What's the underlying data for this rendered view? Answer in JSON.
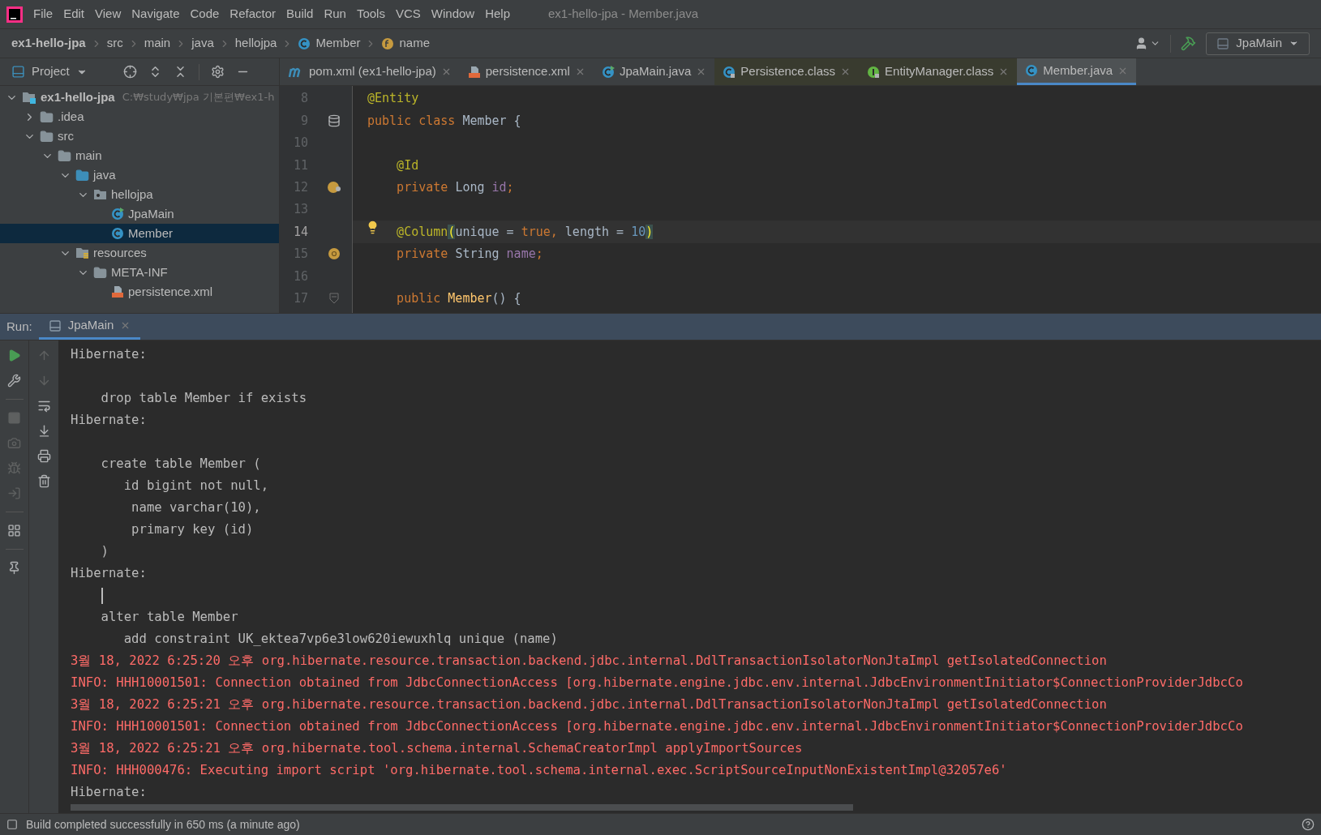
{
  "window": {
    "title": "ex1-hello-jpa - Member.java"
  },
  "menu": [
    "File",
    "Edit",
    "View",
    "Navigate",
    "Code",
    "Refactor",
    "Build",
    "Run",
    "Tools",
    "VCS",
    "Window",
    "Help"
  ],
  "breadcrumbs": [
    {
      "label": "ex1-hello-jpa",
      "kind": "project"
    },
    {
      "label": "src",
      "kind": "folder"
    },
    {
      "label": "main",
      "kind": "folder"
    },
    {
      "label": "java",
      "kind": "folder"
    },
    {
      "label": "hellojpa",
      "kind": "folder"
    },
    {
      "label": "Member",
      "kind": "class"
    },
    {
      "label": "name",
      "kind": "field"
    }
  ],
  "run_config": {
    "label": "JpaMain"
  },
  "project": {
    "title": "Project",
    "tree": [
      {
        "label": "ex1-hello-jpa",
        "hint": "C:₩study₩jpa 기본편₩ex1-h",
        "kind": "module",
        "expanded": true,
        "selected": false,
        "children": [
          {
            "label": ".idea",
            "kind": "folder",
            "expanded": false,
            "selected": false
          },
          {
            "label": "src",
            "kind": "folder",
            "expanded": true,
            "selected": false,
            "children": [
              {
                "label": "main",
                "kind": "folder",
                "expanded": true,
                "selected": false,
                "children": [
                  {
                    "label": "java",
                    "kind": "source",
                    "expanded": true,
                    "selected": false,
                    "children": [
                      {
                        "label": "hellojpa",
                        "kind": "package",
                        "expanded": true,
                        "selected": false,
                        "children": [
                          {
                            "label": "JpaMain",
                            "kind": "class-run",
                            "selected": false
                          },
                          {
                            "label": "Member",
                            "kind": "class",
                            "selected": true
                          }
                        ]
                      }
                    ]
                  },
                  {
                    "label": "resources",
                    "kind": "resources",
                    "expanded": true,
                    "selected": false,
                    "children": [
                      {
                        "label": "META-INF",
                        "kind": "folder",
                        "expanded": true,
                        "selected": false,
                        "children": [
                          {
                            "label": "persistence.xml",
                            "kind": "xml",
                            "selected": false
                          }
                        ]
                      }
                    ]
                  }
                ]
              }
            ]
          }
        ]
      }
    ]
  },
  "tabs": [
    {
      "label": "pom.xml (ex1-hello-jpa)",
      "kind": "maven",
      "selected": false
    },
    {
      "label": "persistence.xml",
      "kind": "xml",
      "selected": false
    },
    {
      "label": "JpaMain.java",
      "kind": "class-run",
      "selected": false
    },
    {
      "label": "Persistence.class",
      "kind": "class-locked",
      "selected": false
    },
    {
      "label": "EntityManager.class",
      "kind": "interface-locked",
      "selected": false
    },
    {
      "label": "Member.java",
      "kind": "class",
      "selected": true
    }
  ],
  "editor": {
    "lines": [
      {
        "number": "8",
        "current": false,
        "bulb": false,
        "tokens": [
          {
            "text": "@Entity",
            "kind": "annotation"
          }
        ]
      },
      {
        "number": "9",
        "current": false,
        "bulb": false,
        "gutter": {
          "kind": "table"
        },
        "tokens": [
          {
            "text": "public class ",
            "kind": "keyword"
          },
          {
            "text": "Member {",
            "kind": "plain"
          }
        ]
      },
      {
        "number": "10",
        "current": false,
        "bulb": false
      },
      {
        "number": "11",
        "current": false,
        "bulb": false,
        "tokens": [
          {
            "text": "    @Id",
            "kind": "annotation"
          }
        ]
      },
      {
        "number": "12",
        "current": false,
        "bulb": false,
        "gutter": {
          "kind": "id-field"
        },
        "tokens": [
          {
            "text": "    private ",
            "kind": "keyword"
          },
          {
            "text": "Long ",
            "kind": "plain"
          },
          {
            "text": "id",
            "kind": "field"
          },
          {
            "text": ";",
            "kind": "keyword"
          }
        ]
      },
      {
        "number": "13",
        "current": false,
        "bulb": false
      },
      {
        "number": "14",
        "current": true,
        "bulb": true,
        "tokens": [
          {
            "text": "    @Column",
            "kind": "annotation"
          },
          {
            "text": "(",
            "kind": "match"
          },
          {
            "text": "unique = ",
            "kind": "plain"
          },
          {
            "text": "true, ",
            "kind": "keyword"
          },
          {
            "text": "length = ",
            "kind": "plain"
          },
          {
            "text": "10",
            "kind": "number"
          },
          {
            "text": ")",
            "kind": "match"
          }
        ]
      },
      {
        "number": "15",
        "current": false,
        "bulb": false,
        "gutter": {
          "kind": "field"
        },
        "tokens": [
          {
            "text": "    private ",
            "kind": "keyword"
          },
          {
            "text": "String ",
            "kind": "plain"
          },
          {
            "text": "name",
            "kind": "field"
          },
          {
            "text": ";",
            "kind": "keyword"
          }
        ]
      },
      {
        "number": "16",
        "current": false,
        "bulb": false
      },
      {
        "number": "17",
        "current": false,
        "bulb": false,
        "gutter": {
          "kind": "fold"
        },
        "tokens": [
          {
            "text": "    public ",
            "kind": "keyword"
          },
          {
            "text": "Member",
            "kind": "method"
          },
          {
            "text": "() {",
            "kind": "plain"
          }
        ]
      }
    ]
  },
  "run": {
    "label": "Run:",
    "tab": {
      "label": "JpaMain",
      "selected": true
    },
    "lines": [
      {
        "kind": "plain",
        "text": "Hibernate:"
      },
      {
        "kind": "blank"
      },
      {
        "kind": "plain",
        "text": "    drop table Member if exists"
      },
      {
        "kind": "plain",
        "text": "Hibernate:"
      },
      {
        "kind": "blank"
      },
      {
        "kind": "plain",
        "text": "    create table Member ("
      },
      {
        "kind": "plain",
        "text": "       id bigint not null,"
      },
      {
        "kind": "plain",
        "text": "        name varchar(10),"
      },
      {
        "kind": "plain",
        "text": "        primary key (id)"
      },
      {
        "kind": "plain",
        "text": "    )"
      },
      {
        "kind": "plain",
        "text": "Hibernate:"
      },
      {
        "kind": "caret"
      },
      {
        "kind": "plain",
        "text": "    alter table Member"
      },
      {
        "kind": "plain",
        "text": "       add constraint UK_ektea7vp6e3low620iewuxhlq unique (name)"
      },
      {
        "kind": "error",
        "text": "3월 18, 2022 6:25:20 오후 org.hibernate.resource.transaction.backend.jdbc.internal.DdlTransactionIsolatorNonJtaImpl getIsolatedConnection"
      },
      {
        "kind": "error",
        "text": "INFO: HHH10001501: Connection obtained from JdbcConnectionAccess [org.hibernate.engine.jdbc.env.internal.JdbcEnvironmentInitiator$ConnectionProviderJdbcCo"
      },
      {
        "kind": "error",
        "text": "3월 18, 2022 6:25:21 오후 org.hibernate.resource.transaction.backend.jdbc.internal.DdlTransactionIsolatorNonJtaImpl getIsolatedConnection"
      },
      {
        "kind": "error",
        "text": "INFO: HHH10001501: Connection obtained from JdbcConnectionAccess [org.hibernate.engine.jdbc.env.internal.JdbcEnvironmentInitiator$ConnectionProviderJdbcCo"
      },
      {
        "kind": "error",
        "text": "3월 18, 2022 6:25:21 오후 org.hibernate.tool.schema.internal.SchemaCreatorImpl applyImportSources"
      },
      {
        "kind": "error",
        "text": "INFO: HHH000476: Executing import script 'org.hibernate.tool.schema.internal.exec.ScriptSourceInputNonExistentImpl@32057e6'"
      },
      {
        "kind": "plain",
        "text": "Hibernate:"
      }
    ]
  },
  "status_bar": {
    "message": "Build completed successfully in 650 ms (a minute ago)"
  }
}
